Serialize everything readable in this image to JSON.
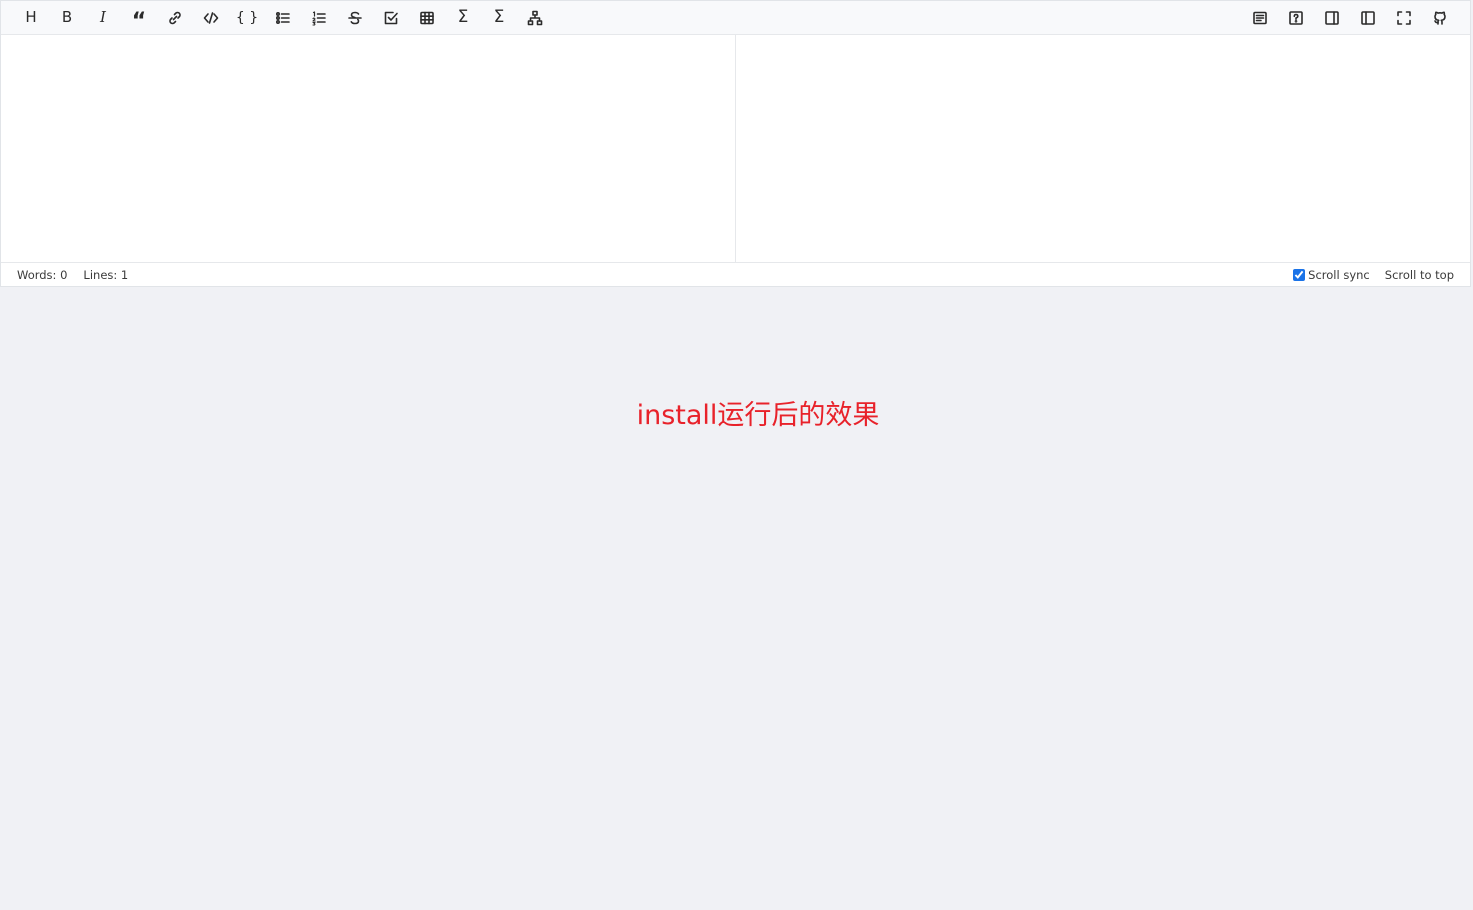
{
  "toolbar": {
    "left_buttons": [
      {
        "icon": "heading-icon",
        "glyph": "H"
      },
      {
        "icon": "bold-icon",
        "glyph": "B"
      },
      {
        "icon": "italic-icon",
        "glyph": "I"
      },
      {
        "icon": "quote-icon",
        "glyph": "“"
      },
      {
        "icon": "link-icon"
      },
      {
        "icon": "code-icon"
      },
      {
        "icon": "code-block-icon",
        "glyph": "{ }"
      },
      {
        "icon": "unordered-list-icon"
      },
      {
        "icon": "ordered-list-icon"
      },
      {
        "icon": "strikethrough-icon"
      },
      {
        "icon": "task-list-icon"
      },
      {
        "icon": "table-icon"
      },
      {
        "icon": "inline-math-icon",
        "glyph": "Σ"
      },
      {
        "icon": "block-math-icon",
        "glyph": "Σ"
      },
      {
        "icon": "mermaid-diagram-icon"
      }
    ],
    "right_buttons": [
      {
        "icon": "toc-icon"
      },
      {
        "icon": "help-icon"
      },
      {
        "icon": "preview-only-icon"
      },
      {
        "icon": "write-only-icon"
      },
      {
        "icon": "fullscreen-icon"
      },
      {
        "icon": "github-icon"
      }
    ]
  },
  "editor": {
    "content": ""
  },
  "status": {
    "words_label": "Words:",
    "words_value": "0",
    "lines_label": "Lines:",
    "lines_value": "1",
    "scroll_sync_label": "Scroll sync",
    "scroll_sync_checked": true,
    "scroll_top_label": "Scroll to top"
  },
  "caption": "install运行后的效果",
  "colors": {
    "caption": "#e8222a",
    "page_background": "#f0f1f5",
    "toolbar_background": "#f8f9fb",
    "checkbox_accent": "#1a73e8"
  }
}
